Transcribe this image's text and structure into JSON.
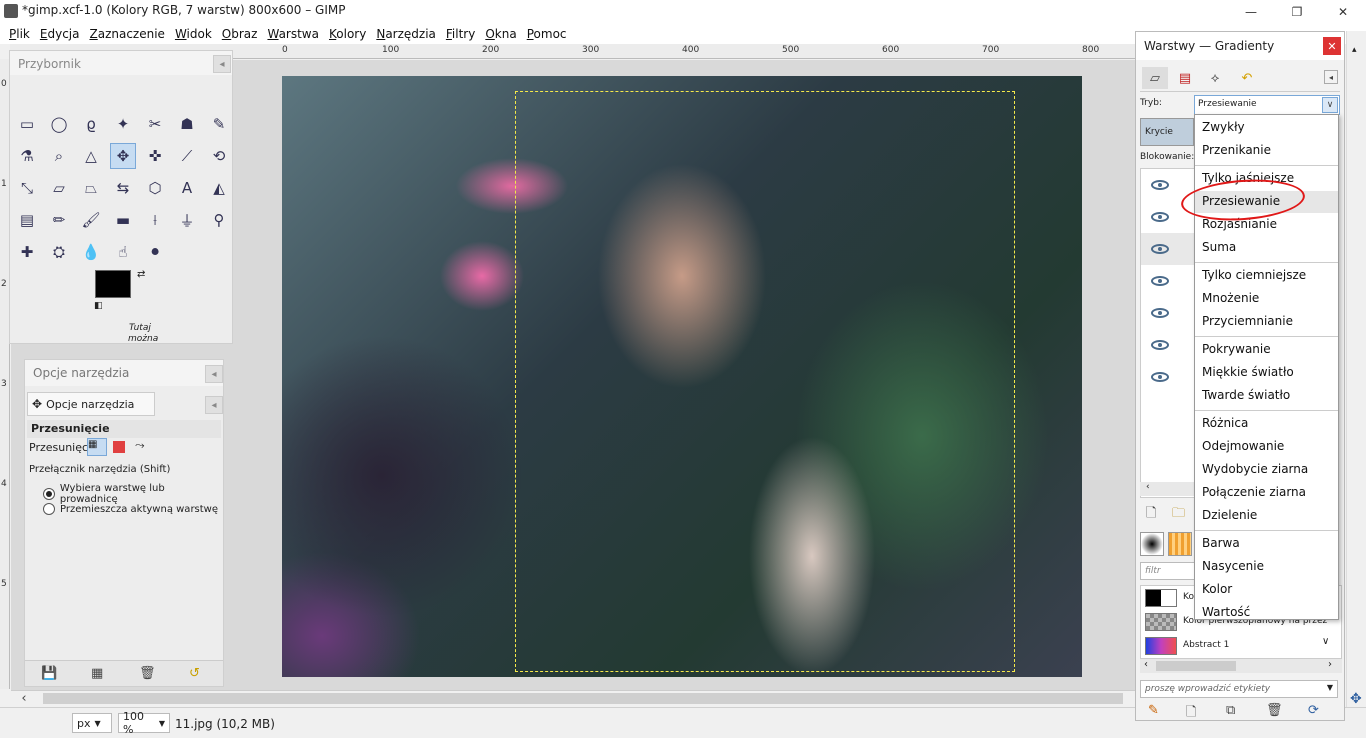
{
  "window": {
    "title": "*gimp.xcf-1.0 (Kolory RGB, 7 warstw) 800x600 – GIMP",
    "minimize_glyph": "—",
    "maximize_glyph": "❐",
    "close_glyph": "✕"
  },
  "menubar": [
    {
      "key": "P",
      "rest": "lik"
    },
    {
      "key": "E",
      "rest": "dycja"
    },
    {
      "key": "Z",
      "rest": "aznaczenie"
    },
    {
      "key": "W",
      "rest": "idok"
    },
    {
      "key": "O",
      "rest": "braz"
    },
    {
      "key": "W",
      "rest": "arstwa"
    },
    {
      "key": "K",
      "rest": "olory"
    },
    {
      "key": "N",
      "rest": "arzędzia"
    },
    {
      "key": "F",
      "rest": "iltry"
    },
    {
      "key": "O",
      "rest": "kna"
    },
    {
      "key": "P",
      "rest": "omoc"
    }
  ],
  "ruler": {
    "h": [
      "0",
      "100",
      "200",
      "300",
      "400",
      "500",
      "600",
      "700",
      "800"
    ],
    "v": [
      "0",
      "1",
      "2",
      "3",
      "4",
      "5"
    ]
  },
  "toolbox": {
    "title": "Przybornik",
    "close_glyph": "◂",
    "tools": [
      {
        "icon": "rect-select-icon",
        "glyph": "▭"
      },
      {
        "icon": "ellipse-select-icon",
        "glyph": "◯"
      },
      {
        "icon": "lasso-icon",
        "glyph": "ϱ"
      },
      {
        "icon": "fuzzy-select-icon",
        "glyph": "✦"
      },
      {
        "icon": "scissors-icon",
        "glyph": "✂"
      },
      {
        "icon": "foreground-select-icon",
        "glyph": "☗"
      },
      {
        "icon": "paths-icon",
        "glyph": "✎"
      },
      {
        "icon": "color-picker-icon",
        "glyph": "⚗"
      },
      {
        "icon": "zoom-icon",
        "glyph": "⌕"
      },
      {
        "icon": "measure-icon",
        "glyph": "△"
      },
      {
        "icon": "move-icon",
        "glyph": "✥"
      },
      {
        "icon": "align-icon",
        "glyph": "✜"
      },
      {
        "icon": "crop-icon",
        "glyph": "⟋"
      },
      {
        "icon": "rotate-icon",
        "glyph": "⟲"
      },
      {
        "icon": "scale-icon",
        "glyph": "⤡"
      },
      {
        "icon": "shear-icon",
        "glyph": "▱"
      },
      {
        "icon": "perspective-icon",
        "glyph": "⏢"
      },
      {
        "icon": "flip-icon",
        "glyph": "⇆"
      },
      {
        "icon": "cage-icon",
        "glyph": "⬡"
      },
      {
        "icon": "text-icon",
        "glyph": "A"
      },
      {
        "icon": "bucket-fill-icon",
        "glyph": "◭"
      },
      {
        "icon": "blend-icon",
        "glyph": "▤"
      },
      {
        "icon": "pencil-icon",
        "glyph": "✏"
      },
      {
        "icon": "paintbrush-icon",
        "glyph": "🖌"
      },
      {
        "icon": "eraser-icon",
        "glyph": "▬"
      },
      {
        "icon": "airbrush-icon",
        "glyph": "⟊"
      },
      {
        "icon": "ink-icon",
        "glyph": "⏚"
      },
      {
        "icon": "clone-icon",
        "glyph": "⚲"
      },
      {
        "icon": "heal-icon",
        "glyph": "✚"
      },
      {
        "icon": "perspective-clone-icon",
        "glyph": "⛭"
      },
      {
        "icon": "blur-icon",
        "glyph": "💧"
      },
      {
        "icon": "smudge-icon",
        "glyph": "☝"
      },
      {
        "icon": "dodge-burn-icon",
        "glyph": "⚫"
      }
    ],
    "hint_line1": "Tutaj",
    "hint_line2": "można"
  },
  "tool_options": {
    "title": "Opcje narzędzia",
    "tab_label": "Opcje narzędzia",
    "section": "Przesunięcie",
    "move_label": "Przesunięcie:",
    "toggle_label": "Przełącznik narzędzia  (Shift)",
    "option1": "Wybiera warstwę lub prowadnicę",
    "option2": "Przemieszcza aktywną warstwę",
    "selected_option": 1
  },
  "layers": {
    "dock_title": "Warstwy — Gradienty",
    "mode_label": "Tryb:",
    "mode_value": "Przesiewanie",
    "opacity_label": "Krycie",
    "lock_label": "Blokowanie:",
    "gradient_filter_placeholder": "filtr",
    "gradients": [
      {
        "name": "Kolor",
        "preview": "bw"
      },
      {
        "name": "Kolor pierwszoplanowy na przez",
        "preview": "fade"
      },
      {
        "name": "Abstract 1",
        "preview": "abstract"
      }
    ],
    "tag_placeholder": "proszę wprowadzić etykiety"
  },
  "dropdown": {
    "groups": [
      [
        "Zwykły",
        "Przenikanie"
      ],
      [
        "Tylko jaśniejsze",
        "Przesiewanie",
        "Rozjaśnianie",
        "Suma"
      ],
      [
        "Tylko ciemniejsze",
        "Mnożenie",
        "Przyciemnianie"
      ],
      [
        "Pokrywanie",
        "Miękkie światło",
        "Twarde światło"
      ],
      [
        "Różnica",
        "Odejmowanie",
        "Wydobycie ziarna",
        "Połączenie ziarna",
        "Dzielenie"
      ],
      [
        "Barwa",
        "Nasycenie",
        "Kolor",
        "Wartość"
      ]
    ],
    "selected": "Przesiewanie"
  },
  "statusbar": {
    "unit": "px",
    "zoom": "100 %",
    "info": "11.jpg (10,2 MB)"
  },
  "colors": {
    "selection_border": "#f5e94a",
    "annotation_circle": "#e01818",
    "close_button": "#dd3333"
  }
}
